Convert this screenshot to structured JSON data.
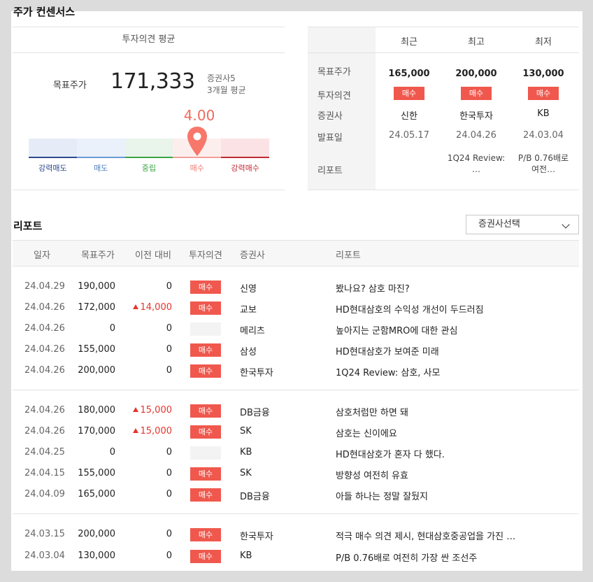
{
  "section_title": "주가 컨센서스",
  "consensus": {
    "header": "투자의견 평균",
    "target_price_label": "목표주가",
    "target_price_value": "171,333",
    "meta_firms": "증권사5",
    "meta_period": "3개월 평균",
    "score": "4.00",
    "score_value": 4.0,
    "scale_labels": [
      "강력매도",
      "매도",
      "중립",
      "매수",
      "강력매수"
    ],
    "scale_colors": [
      "#2d4a8a",
      "#6a9ad6",
      "#3ba544",
      "#f2a09a",
      "#c22a35"
    ]
  },
  "summary": {
    "columns": [
      "최근",
      "최고",
      "최저"
    ],
    "row_labels": [
      "목표주가",
      "투자의견",
      "증권사",
      "발표일",
      "리포트"
    ],
    "cells": [
      {
        "price": "165,000",
        "opinion": "매수",
        "firm": "신한",
        "date": "24.05.17",
        "report": ""
      },
      {
        "price": "200,000",
        "opinion": "매수",
        "firm": "한국투자",
        "date": "24.04.26",
        "report": "1Q24 Review: …"
      },
      {
        "price": "130,000",
        "opinion": "매수",
        "firm": "KB",
        "date": "24.03.04",
        "report": "P/B 0.76배로 여전…"
      }
    ]
  },
  "reports": {
    "title": "리포트",
    "dropdown_label": "증권사선택",
    "headers": [
      "일자",
      "목표주가",
      "이전 대비",
      "투자의견",
      "증권사",
      "리포트"
    ],
    "rows": [
      {
        "date": "24.04.29",
        "tp": "190,000",
        "chg": "0",
        "up": false,
        "op": "매수",
        "firm": "신영",
        "title": "봤나요? 삼호 마진?"
      },
      {
        "date": "24.04.26",
        "tp": "172,000",
        "chg": "14,000",
        "up": true,
        "op": "매수",
        "firm": "교보",
        "title": "HD현대삼호의 수익성 개선이 두드러짐"
      },
      {
        "date": "24.04.26",
        "tp": "0",
        "chg": "0",
        "up": false,
        "op": "",
        "firm": "메리츠",
        "title": "높아지는 군함MRO에 대한 관심"
      },
      {
        "date": "24.04.26",
        "tp": "155,000",
        "chg": "0",
        "up": false,
        "op": "매수",
        "firm": "삼성",
        "title": "HD현대삼호가 보여준 미래"
      },
      {
        "date": "24.04.26",
        "tp": "200,000",
        "chg": "0",
        "up": false,
        "op": "매수",
        "firm": "한국투자",
        "title": "1Q24 Review: 삼호, 사모"
      },
      {
        "date": "24.04.26",
        "tp": "180,000",
        "chg": "15,000",
        "up": true,
        "op": "매수",
        "firm": "DB금융",
        "title": "삼호처럼만 하면 돼"
      },
      {
        "date": "24.04.26",
        "tp": "170,000",
        "chg": "15,000",
        "up": true,
        "op": "매수",
        "firm": "SK",
        "title": "삼호는 신이에요"
      },
      {
        "date": "24.04.25",
        "tp": "0",
        "chg": "0",
        "up": false,
        "op": "",
        "firm": "KB",
        "title": "HD현대삼호가 혼자 다 했다."
      },
      {
        "date": "24.04.15",
        "tp": "155,000",
        "chg": "0",
        "up": false,
        "op": "매수",
        "firm": "SK",
        "title": "방향성 여전히 유효"
      },
      {
        "date": "24.04.09",
        "tp": "165,000",
        "chg": "0",
        "up": false,
        "op": "매수",
        "firm": "DB금융",
        "title": "아들 하나는 정말 잘뒀지"
      },
      {
        "date": "24.03.15",
        "tp": "200,000",
        "chg": "0",
        "up": false,
        "op": "매수",
        "firm": "한국투자",
        "title": "적극 매수 의견 제시, 현대삼호중공업을 가진 …"
      },
      {
        "date": "24.03.04",
        "tp": "130,000",
        "chg": "0",
        "up": false,
        "op": "매수",
        "firm": "KB",
        "title": "P/B 0.76배로 여전히 가장 싼 조선주"
      }
    ]
  }
}
